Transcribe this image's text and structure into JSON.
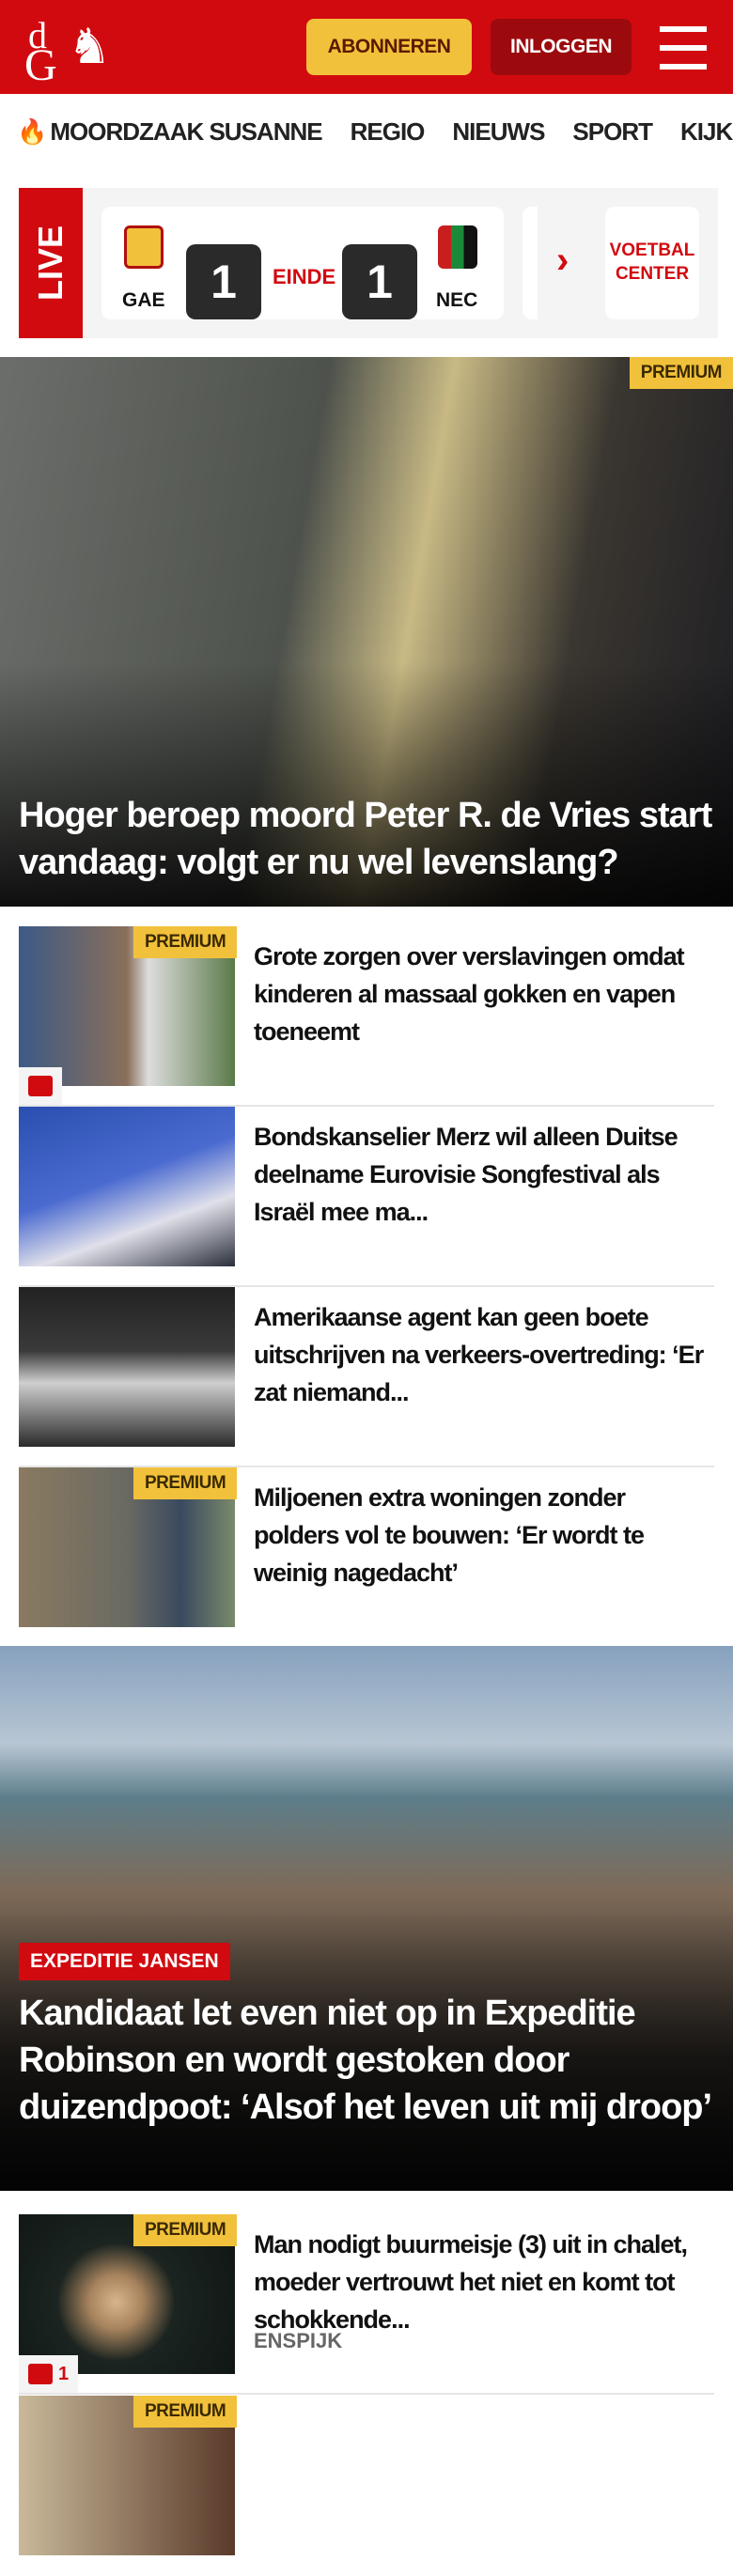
{
  "header": {
    "logo_text": "dG",
    "subscribe": "ABONNEREN",
    "login": "INLOGGEN",
    "brand_color": "#d10a10"
  },
  "nav": {
    "items": [
      "MOORDZAAK SUSANNE",
      "REGIO",
      "NIEUWS",
      "SPORT",
      "KIJK"
    ]
  },
  "live": {
    "label": "LIVE",
    "home": "GAE",
    "home_score": "1",
    "status": "EINDE",
    "away_score": "1",
    "away": "NEC",
    "link": "VOETBAL CENTER"
  },
  "hero": {
    "badge": "PREMIUM",
    "title": "Hoger beroep moord Peter R. de Vries start vandaag: volgt er nu wel levenslang?"
  },
  "articles": [
    {
      "badge": "PREMIUM",
      "title": "Grote zorgen over verslavingen omdat kinderen al massaal gokken en vapen toeneemt",
      "comments": ""
    },
    {
      "title": "Bondskanselier Merz wil alleen Duitse deelname Eurovisie Songfestival als Israël mee ma..."
    },
    {
      "title": "Amerikaanse agent kan geen boete uitschrijven na verkeers-overtreding: ‘Er zat niemand..."
    },
    {
      "badge": "PREMIUM",
      "title": "Miljoenen extra woningen zonder polders vol te bouwen: ‘Er wordt te weinig nagedacht’"
    }
  ],
  "feature": {
    "kicker": "EXPEDITIE JANSEN",
    "title": "Kandidaat let even niet op in Expeditie Robinson en wordt gestoken door duizendpoot: ‘Alsof het leven uit mij droop’"
  },
  "articles2": [
    {
      "badge": "PREMIUM",
      "title": "Man nodigt buurmeisje (3) uit in chalet, moeder vertrouwt het niet en komt tot schokkende...",
      "location": "ENSPIJK",
      "comments": "1"
    },
    {
      "badge": "PREMIUM"
    }
  ]
}
